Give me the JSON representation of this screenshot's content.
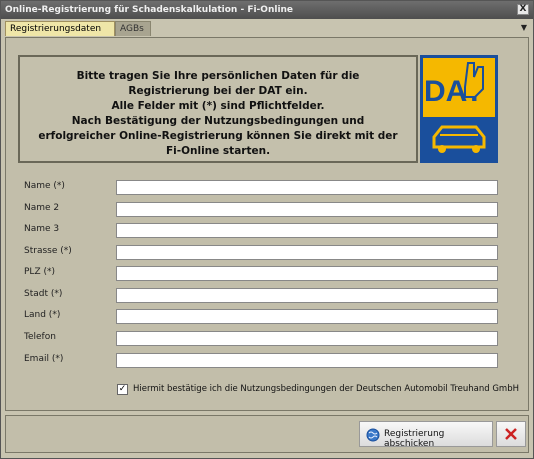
{
  "window": {
    "title": "Online-Registrierung für Schadenskalkulation - Fi-Online",
    "close_glyph": "X"
  },
  "tabs": [
    {
      "label": "Registrierungsdaten",
      "active": true
    },
    {
      "label": "AGBs",
      "active": false
    }
  ],
  "banner": {
    "text": "Bitte tragen Sie Ihre persönlichen Daten für die\nRegistrierung bei der DAT ein.\nAlle Felder mit (*) sind Pflichtfelder.\nNach Bestätigung der Nutzungsbedingungen und\nerfolgreicher Online-Registrierung können Sie direkt mit der\nFi-Online starten.",
    "logo_text": "DAT"
  },
  "form": {
    "fields": [
      {
        "label": "Name (*)",
        "value": ""
      },
      {
        "label": "Name 2",
        "value": ""
      },
      {
        "label": "Name 3",
        "value": ""
      },
      {
        "label": "Strasse (*)",
        "value": ""
      },
      {
        "label": "PLZ (*)",
        "value": ""
      },
      {
        "label": "Stadt (*)",
        "value": ""
      },
      {
        "label": "Land (*)",
        "value": ""
      },
      {
        "label": "Telefon",
        "value": ""
      },
      {
        "label": "Email (*)",
        "value": ""
      }
    ],
    "terms_checked": true,
    "terms_label": "Hiermit bestätige ich die Nutzungsbedingungen der Deutschen Automobil Treuhand GmbH"
  },
  "footer": {
    "submit_label": "Registrierung abschicken"
  },
  "colors": {
    "logo_yellow": "#f5b800",
    "logo_blue": "#1a4f9c",
    "cancel_red": "#cc2222"
  }
}
